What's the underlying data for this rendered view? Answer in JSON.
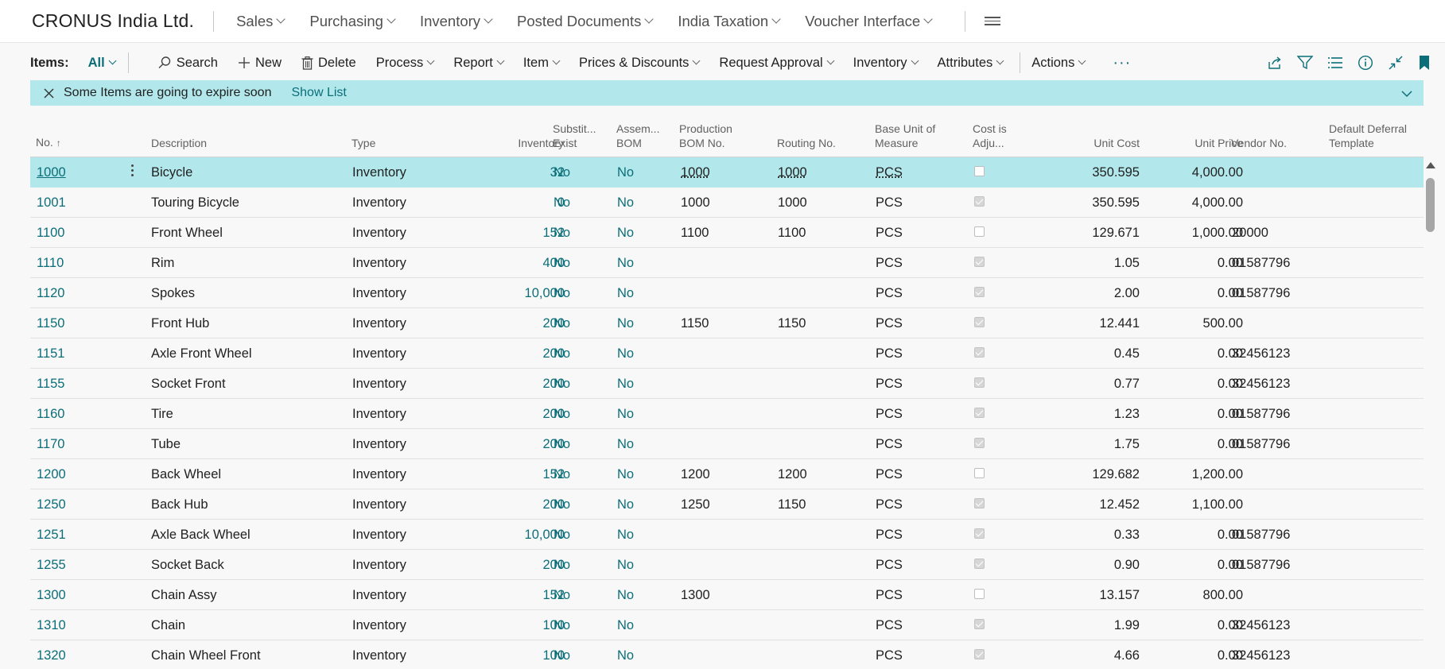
{
  "company": "CRONUS India Ltd.",
  "nav": [
    "Sales",
    "Purchasing",
    "Inventory",
    "Posted Documents",
    "India Taxation",
    "Voucher Interface"
  ],
  "actionbar": {
    "items_label": "Items:",
    "filter": "All",
    "search": "Search",
    "new": "New",
    "delete": "Delete",
    "menus": [
      "Process",
      "Report",
      "Item",
      "Prices & Discounts",
      "Request Approval",
      "Inventory",
      "Attributes"
    ],
    "actions": "Actions",
    "more": "···"
  },
  "notification": {
    "message": "Some Items are going to expire soon",
    "link": "Show List"
  },
  "columns": {
    "no": "No.",
    "sort_arrow": "↑",
    "description": "Description",
    "type": "Type",
    "inventory": "Inventory",
    "subst_1": "Substit...",
    "subst_2": "Exist",
    "assem_1": "Assem...",
    "assem_2": "BOM",
    "prodbom_1": "Production",
    "prodbom_2": "BOM No.",
    "routing": "Routing No.",
    "baseuom_1": "Base Unit of",
    "baseuom_2": "Measure",
    "costadj_1": "Cost is",
    "costadj_2": "Adju...",
    "unitcost": "Unit Cost",
    "unitprice": "Unit Price",
    "vendor": "Vendor No.",
    "deferral_1": "Default Deferral",
    "deferral_2": "Template"
  },
  "rows": [
    {
      "no": "1000",
      "desc": "Bicycle",
      "type": "Inventory",
      "inv": "32",
      "subst": "No",
      "assem": "No",
      "prodbom": "1000",
      "routing": "1000",
      "uom": "PCS",
      "costadj": false,
      "unitcost": "350.595",
      "unitprice": "4,000.00",
      "vendor": ""
    },
    {
      "no": "1001",
      "desc": "Touring Bicycle",
      "type": "Inventory",
      "inv": "0",
      "subst": "No",
      "assem": "No",
      "prodbom": "1000",
      "routing": "1000",
      "uom": "PCS",
      "costadj": true,
      "unitcost": "350.595",
      "unitprice": "4,000.00",
      "vendor": ""
    },
    {
      "no": "1100",
      "desc": "Front Wheel",
      "type": "Inventory",
      "inv": "152",
      "subst": "No",
      "assem": "No",
      "prodbom": "1100",
      "routing": "1100",
      "uom": "PCS",
      "costadj": false,
      "unitcost": "129.671",
      "unitprice": "1,000.00",
      "vendor": "20000"
    },
    {
      "no": "1110",
      "desc": "Rim",
      "type": "Inventory",
      "inv": "400",
      "subst": "No",
      "assem": "No",
      "prodbom": "",
      "routing": "",
      "uom": "PCS",
      "costadj": true,
      "unitcost": "1.05",
      "unitprice": "0.00",
      "vendor": "01587796"
    },
    {
      "no": "1120",
      "desc": "Spokes",
      "type": "Inventory",
      "inv": "10,000",
      "subst": "No",
      "assem": "No",
      "prodbom": "",
      "routing": "",
      "uom": "PCS",
      "costadj": true,
      "unitcost": "2.00",
      "unitprice": "0.00",
      "vendor": "01587796"
    },
    {
      "no": "1150",
      "desc": "Front Hub",
      "type": "Inventory",
      "inv": "200",
      "subst": "No",
      "assem": "No",
      "prodbom": "1150",
      "routing": "1150",
      "uom": "PCS",
      "costadj": true,
      "unitcost": "12.441",
      "unitprice": "500.00",
      "vendor": ""
    },
    {
      "no": "1151",
      "desc": "Axle Front Wheel",
      "type": "Inventory",
      "inv": "200",
      "subst": "No",
      "assem": "No",
      "prodbom": "",
      "routing": "",
      "uom": "PCS",
      "costadj": true,
      "unitcost": "0.45",
      "unitprice": "0.00",
      "vendor": "32456123"
    },
    {
      "no": "1155",
      "desc": "Socket Front",
      "type": "Inventory",
      "inv": "200",
      "subst": "No",
      "assem": "No",
      "prodbom": "",
      "routing": "",
      "uom": "PCS",
      "costadj": true,
      "unitcost": "0.77",
      "unitprice": "0.00",
      "vendor": "32456123"
    },
    {
      "no": "1160",
      "desc": "Tire",
      "type": "Inventory",
      "inv": "200",
      "subst": "No",
      "assem": "No",
      "prodbom": "",
      "routing": "",
      "uom": "PCS",
      "costadj": true,
      "unitcost": "1.23",
      "unitprice": "0.00",
      "vendor": "01587796"
    },
    {
      "no": "1170",
      "desc": "Tube",
      "type": "Inventory",
      "inv": "200",
      "subst": "No",
      "assem": "No",
      "prodbom": "",
      "routing": "",
      "uom": "PCS",
      "costadj": true,
      "unitcost": "1.75",
      "unitprice": "0.00",
      "vendor": "01587796"
    },
    {
      "no": "1200",
      "desc": "Back Wheel",
      "type": "Inventory",
      "inv": "152",
      "subst": "No",
      "assem": "No",
      "prodbom": "1200",
      "routing": "1200",
      "uom": "PCS",
      "costadj": false,
      "unitcost": "129.682",
      "unitprice": "1,200.00",
      "vendor": ""
    },
    {
      "no": "1250",
      "desc": "Back Hub",
      "type": "Inventory",
      "inv": "200",
      "subst": "No",
      "assem": "No",
      "prodbom": "1250",
      "routing": "1150",
      "uom": "PCS",
      "costadj": true,
      "unitcost": "12.452",
      "unitprice": "1,100.00",
      "vendor": ""
    },
    {
      "no": "1251",
      "desc": "Axle Back Wheel",
      "type": "Inventory",
      "inv": "10,000",
      "subst": "No",
      "assem": "No",
      "prodbom": "",
      "routing": "",
      "uom": "PCS",
      "costadj": true,
      "unitcost": "0.33",
      "unitprice": "0.00",
      "vendor": "01587796"
    },
    {
      "no": "1255",
      "desc": "Socket Back",
      "type": "Inventory",
      "inv": "200",
      "subst": "No",
      "assem": "No",
      "prodbom": "",
      "routing": "",
      "uom": "PCS",
      "costadj": true,
      "unitcost": "0.90",
      "unitprice": "0.00",
      "vendor": "01587796"
    },
    {
      "no": "1300",
      "desc": "Chain Assy",
      "type": "Inventory",
      "inv": "152",
      "subst": "No",
      "assem": "No",
      "prodbom": "1300",
      "routing": "",
      "uom": "PCS",
      "costadj": false,
      "unitcost": "13.157",
      "unitprice": "800.00",
      "vendor": ""
    },
    {
      "no": "1310",
      "desc": "Chain",
      "type": "Inventory",
      "inv": "100",
      "subst": "No",
      "assem": "No",
      "prodbom": "",
      "routing": "",
      "uom": "PCS",
      "costadj": true,
      "unitcost": "1.99",
      "unitprice": "0.00",
      "vendor": "32456123"
    },
    {
      "no": "1320",
      "desc": "Chain Wheel Front",
      "type": "Inventory",
      "inv": "100",
      "subst": "No",
      "assem": "No",
      "prodbom": "",
      "routing": "",
      "uom": "PCS",
      "costadj": true,
      "unitcost": "4.66",
      "unitprice": "0.00",
      "vendor": "32456123"
    }
  ],
  "colors": {
    "accent": "#0b6e79",
    "selected_row": "#b2e8ec",
    "notification_bg": "#b2e8ec"
  },
  "icons": [
    "search-icon",
    "plus-icon",
    "trash-icon",
    "share-icon",
    "filter-icon",
    "list-view-icon",
    "info-icon",
    "collapse-icon",
    "bookmark-icon",
    "close-icon",
    "hamburger-icon",
    "kebab-icon"
  ]
}
